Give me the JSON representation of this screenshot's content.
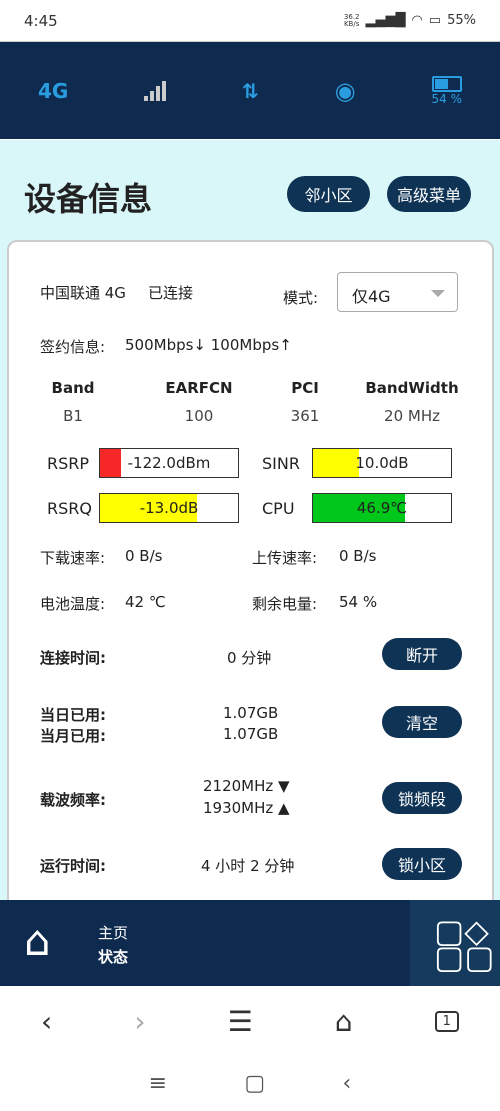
{
  "status_bar": {
    "time": "4:45",
    "net_speed": "36.2",
    "net_unit": "KB/s",
    "battery": "55%"
  },
  "top_bar": {
    "network": "4G",
    "battery_percent": "54 %",
    "battery_level": 0.54
  },
  "header": {
    "title": "设备信息",
    "neighbor_cell": "邻小区",
    "advanced_menu": "高级菜单"
  },
  "card": {
    "operator": "中国联通 4G",
    "conn_state": "已连接",
    "mode_label": "模式:",
    "mode_value": "仅4G",
    "subscription_label": "签约信息:",
    "subscription_value": "500Mbps↓  100Mbps↑",
    "cell_headers": [
      "Band",
      "EARFCN",
      "PCI",
      "BandWidth"
    ],
    "cell_values": [
      "B1",
      "100",
      "361",
      "20 MHz"
    ],
    "gauges": [
      {
        "label": "RSRP",
        "value": "-122.0dBm",
        "fill": 0.15,
        "color": "#f52727"
      },
      {
        "label": "SINR",
        "value": "10.0dB",
        "fill": 0.33,
        "color": "#ffff00"
      },
      {
        "label": "RSRQ",
        "value": "-13.0dB",
        "fill": 0.7,
        "color": "#ffff00"
      },
      {
        "label": "CPU",
        "value": "46.9℃",
        "fill": 0.67,
        "color": "#00c81a"
      }
    ],
    "download_label": "下载速率:",
    "download_value": "0 B/s",
    "upload_label": "上传速率:",
    "upload_value": "0 B/s",
    "battery_temp_label": "电池温度:",
    "battery_temp_value": "42 ℃",
    "battery_left_label": "剩余电量:",
    "battery_left_value": "54 %",
    "conn_time_label": "连接时间:",
    "conn_time_value": "0 分钟",
    "disconnect": "断开",
    "day_used_label": "当日已用:",
    "day_used_value": "1.07GB",
    "month_used_label": "当月已用:",
    "month_used_value": "1.07GB",
    "clear": "清空",
    "carrier_label": "载波频率:",
    "carrier_down": "2120MHz ▼",
    "carrier_up": "1930MHz ▲",
    "lock_band": "锁频段",
    "uptime_label": "运行时间:",
    "uptime_value": "4 小时 2 分钟",
    "lock_cell": "锁小区"
  },
  "bottom_nav": {
    "home": "主页",
    "status": "状态"
  },
  "browser": {
    "tabs_count": "1"
  }
}
